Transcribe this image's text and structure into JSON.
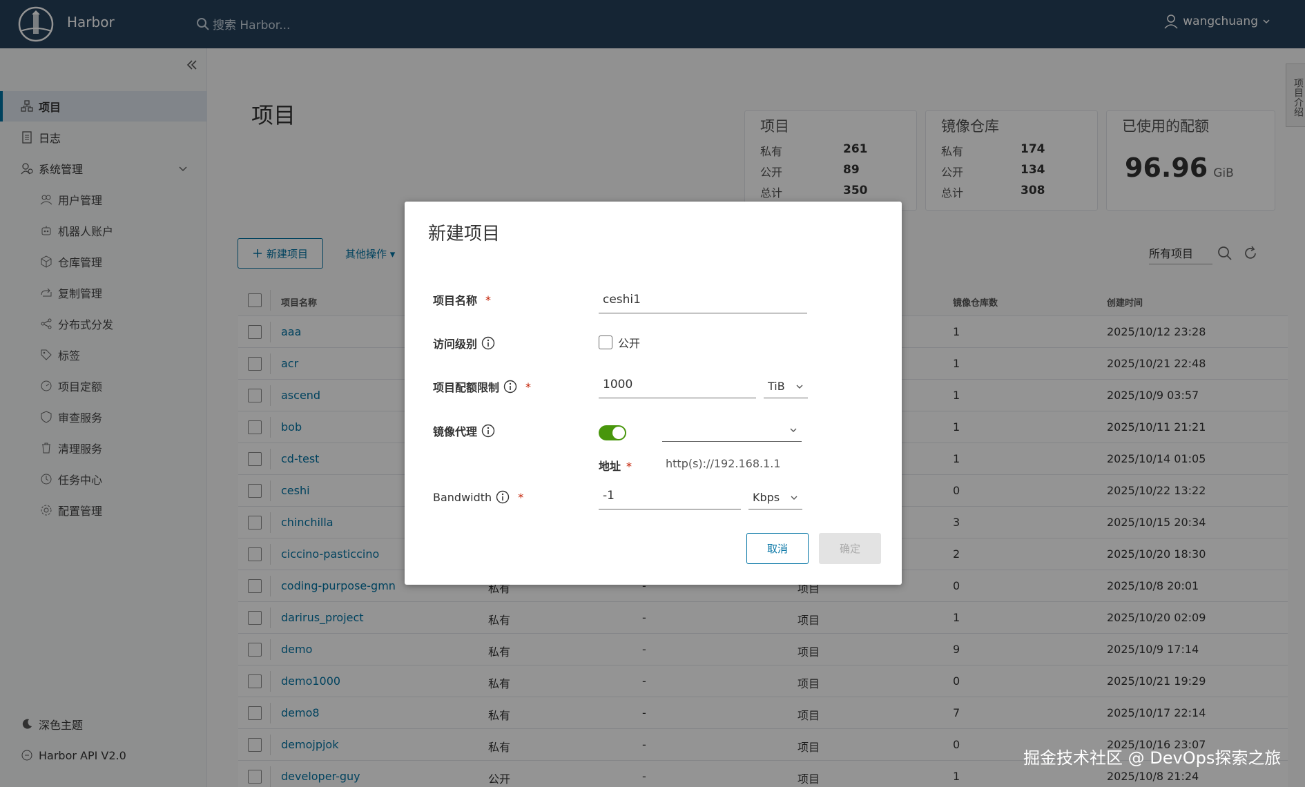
{
  "header": {
    "app_name": "Harbor",
    "search_placeholder": "搜索 Harbor...",
    "username": "wangchuang"
  },
  "sidebar": {
    "items": [
      {
        "label": "项目",
        "icon": "projects-icon",
        "active": true
      },
      {
        "label": "日志",
        "icon": "logs-icon"
      },
      {
        "label": "系统管理",
        "icon": "admin-icon"
      }
    ],
    "sub_items": [
      {
        "label": "用户管理",
        "icon": "users-icon"
      },
      {
        "label": "机器人账户",
        "icon": "robot-icon"
      },
      {
        "label": "仓库管理",
        "icon": "registry-icon"
      },
      {
        "label": "复制管理",
        "icon": "replication-icon"
      },
      {
        "label": "分布式分发",
        "icon": "distribution-icon"
      },
      {
        "label": "标签",
        "icon": "tag-icon"
      },
      {
        "label": "项目定额",
        "icon": "quota-icon"
      },
      {
        "label": "审查服务",
        "icon": "scanner-icon"
      },
      {
        "label": "清理服务",
        "icon": "trash-icon"
      },
      {
        "label": "任务中心",
        "icon": "job-icon"
      },
      {
        "label": "配置管理",
        "icon": "config-icon"
      }
    ],
    "dark_theme": "深色主题",
    "api": "Harbor API V2.0"
  },
  "main": {
    "title": "项目",
    "stats": {
      "projects": {
        "title": "项目",
        "private_label": "私有",
        "private": "261",
        "public_label": "公开",
        "public": "89",
        "total_label": "总计",
        "total": "350"
      },
      "repos": {
        "title": "镜像仓库",
        "private_label": "私有",
        "private": "174",
        "public_label": "公开",
        "public": "134",
        "total_label": "总计",
        "total": "308"
      },
      "quota": {
        "title": "已使用的配额",
        "value": "96.96",
        "unit": "GiB"
      }
    },
    "new_project_btn": "新建项目",
    "more_actions": "其他操作",
    "filter": "所有项目",
    "columns": {
      "name": "项目名称",
      "repos": "镜像仓库数",
      "created": "创建时间"
    },
    "rows": [
      {
        "name": "aaa",
        "access": "",
        "role": "",
        "type": "",
        "repos": "1",
        "created": "2025/10/12 23:28"
      },
      {
        "name": "acr",
        "access": "",
        "role": "",
        "type": "",
        "repos": "1",
        "created": "2025/10/21 22:48"
      },
      {
        "name": "ascend",
        "access": "",
        "role": "",
        "type": "",
        "repos": "1",
        "created": "2025/10/9 03:57"
      },
      {
        "name": "bob",
        "access": "",
        "role": "",
        "type": "",
        "repos": "1",
        "created": "2025/10/11 21:21"
      },
      {
        "name": "cd-test",
        "access": "",
        "role": "",
        "type": "",
        "repos": "1",
        "created": "2025/10/14 01:05"
      },
      {
        "name": "ceshi",
        "access": "",
        "role": "",
        "type": "",
        "repos": "0",
        "created": "2025/10/22 13:22"
      },
      {
        "name": "chinchilla",
        "access": "",
        "role": "",
        "type": "",
        "repos": "3",
        "created": "2025/10/15 20:34"
      },
      {
        "name": "ciccino-pasticcino",
        "access": "",
        "role": "",
        "type": "",
        "repos": "2",
        "created": "2025/10/20 18:30"
      },
      {
        "name": "coding-purpose-gmn",
        "access": "私有",
        "role": "-",
        "type": "项目",
        "repos": "0",
        "created": "2025/10/8 20:01"
      },
      {
        "name": "darirus_project",
        "access": "私有",
        "role": "-",
        "type": "项目",
        "repos": "1",
        "created": "2025/10/20 02:09"
      },
      {
        "name": "demo",
        "access": "私有",
        "role": "-",
        "type": "项目",
        "repos": "9",
        "created": "2025/10/9 17:14"
      },
      {
        "name": "demo1000",
        "access": "私有",
        "role": "-",
        "type": "项目",
        "repos": "0",
        "created": "2025/10/21 19:29"
      },
      {
        "name": "demo8",
        "access": "私有",
        "role": "-",
        "type": "项目",
        "repos": "7",
        "created": "2025/10/17 22:14"
      },
      {
        "name": "demojpjok",
        "access": "私有",
        "role": "-",
        "type": "项目",
        "repos": "0",
        "created": "2025/10/16 23:07"
      },
      {
        "name": "developer-guy",
        "access": "公开",
        "role": "-",
        "type": "项目",
        "repos": "1",
        "created": "2025/10/8 21:24"
      }
    ]
  },
  "right_tab": "项目介绍",
  "modal": {
    "title": "新建项目",
    "name_label": "项目名称",
    "name_value": "ceshi1",
    "access_label": "访问级别",
    "public_label": "公开",
    "quota_label": "项目配额限制",
    "quota_value": "1000",
    "quota_unit": "TiB",
    "proxy_label": "镜像代理",
    "proxy_enabled": true,
    "proxy_endpoint": "",
    "addr_label": "地址",
    "addr_value": "http(s)://192.168.1.1",
    "bandwidth_label": "Bandwidth",
    "bandwidth_value": "-1",
    "bandwidth_unit": "Kbps",
    "cancel": "取消",
    "ok": "确定"
  },
  "watermark": "掘金技术社区 @ DevOps探索之旅",
  "colors": {
    "header": "#25405a",
    "accent": "#0072a3",
    "toggle": "#48960c",
    "required": "#c21d00"
  }
}
